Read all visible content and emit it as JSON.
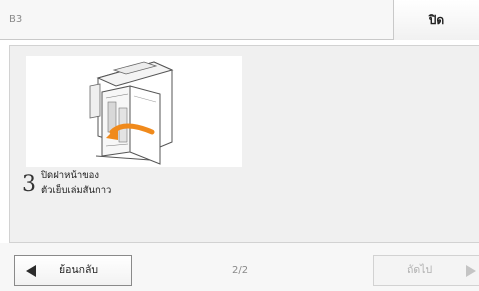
{
  "header": {
    "code": "B3",
    "close_label": "ปิด"
  },
  "step": {
    "number": "3",
    "line1": "ปิดฝาหน้าของ",
    "line2": "ตัวเย็บเล่มสันกาว",
    "illustration_icon": "finisher-front-cover-close-illustration",
    "arrow_color": "#f08a1c"
  },
  "footer": {
    "back_label": "ย้อนกลับ",
    "page_indicator": "2/2",
    "next_label": "ถัดไป",
    "next_enabled": false
  }
}
